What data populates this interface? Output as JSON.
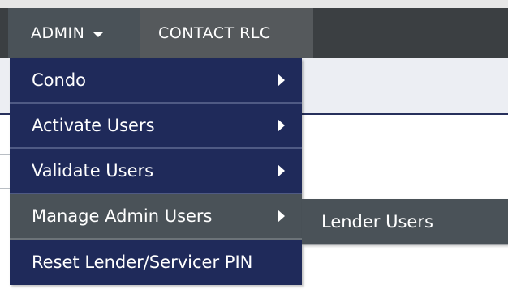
{
  "nav": {
    "admin_label": "ADMIN",
    "contact_label": "CONTACT RLC"
  },
  "admin_menu": {
    "items": [
      {
        "label": "Condo",
        "has_submenu": true
      },
      {
        "label": "Activate Users",
        "has_submenu": true
      },
      {
        "label": "Validate Users",
        "has_submenu": true
      },
      {
        "label": "Manage Admin Users",
        "has_submenu": true
      },
      {
        "label": "Reset Lender/Servicer PIN",
        "has_submenu": false
      }
    ],
    "active_index": 3
  },
  "submenu": {
    "items": [
      {
        "label": "Lender Users"
      }
    ]
  },
  "icons": {
    "caret": "chevron-down-icon",
    "submenu_arrow": "chevron-right-icon"
  },
  "colors": {
    "nav_bar": "#3b3f42",
    "nav_active": "#4a5258",
    "menu_bg": "#1f2a5a",
    "menu_hover": "#4a5258"
  }
}
